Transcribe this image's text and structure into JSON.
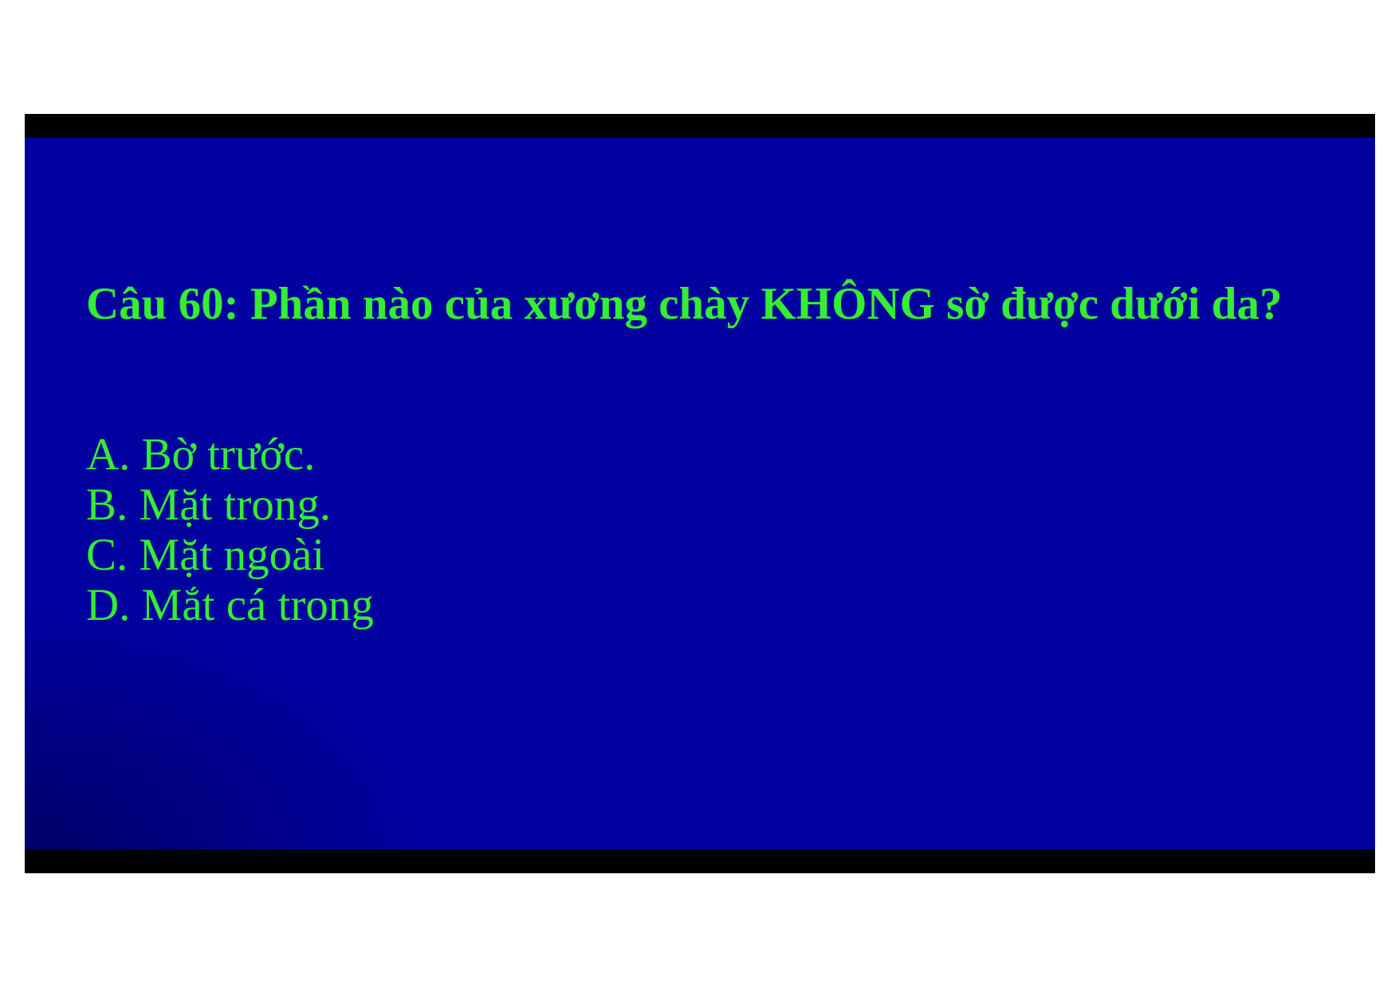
{
  "slide": {
    "question": "Câu 60:  Phần nào của xương chày KHÔNG sờ được dưới da?",
    "options": [
      "A. Bờ trước.",
      "B. Mặt trong.",
      "C. Mặt ngoài",
      "D. Mắt cá trong"
    ]
  },
  "colors": {
    "background": "#00009e",
    "text": "#33ee33",
    "frame": "#000000",
    "page": "#ffffff"
  }
}
